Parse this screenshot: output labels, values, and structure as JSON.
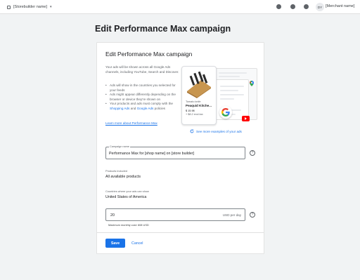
{
  "topbar": {
    "store_selector": "[Storebuilder name]",
    "avatar_initials": "DY",
    "merchant_name": "[Merchant name]"
  },
  "page": {
    "title": "Edit Performance Max campaign"
  },
  "card": {
    "title": "Edit Performance Max campaign",
    "intro": "Your ads will be shown across all Google Ads channels, including YouTube, Search and Discover.",
    "bullets": [
      "Ads will show in the countries you selected for your feeds",
      "Ads might appear differently depending on the browser or device they're shown on"
    ],
    "policy_prefix": "Your products and ads must comply with the",
    "shopping_ads_link": "Shopping Ads",
    "policy_and": "and",
    "google_ads_link": "Google Ads",
    "policy_suffix": "policies",
    "learn_more": "Learn more about Performance Max",
    "see_more": "See more examples of your ads"
  },
  "illustration": {
    "product_brand": "Tomato knife",
    "product_name": "Peaquid Kitche...",
    "product_price": "$ 15.98",
    "product_shipping": "+ $8.2 excl.tax"
  },
  "campaign_name": {
    "label": "Campaign name",
    "value": "Performance Max for [shop name] on [store builder]"
  },
  "products": {
    "label": "Products included",
    "value": "All available products"
  },
  "countries": {
    "label": "Countries where your ads can show",
    "value": "United States of America"
  },
  "budget": {
    "value": "20",
    "suffix": "USD per day",
    "caption": "Maximum monthly cost: 608 USD"
  },
  "actions": {
    "save": "Save",
    "cancel": "Cancel"
  },
  "colors": {
    "accent": "#1a73e8",
    "youtube": "#ff0000"
  },
  "icons": [
    "store-icon",
    "chevron-down-icon",
    "help-icon",
    "refresh-icon",
    "google-logo-icon",
    "youtube-icon",
    "map-pin-icon"
  ]
}
